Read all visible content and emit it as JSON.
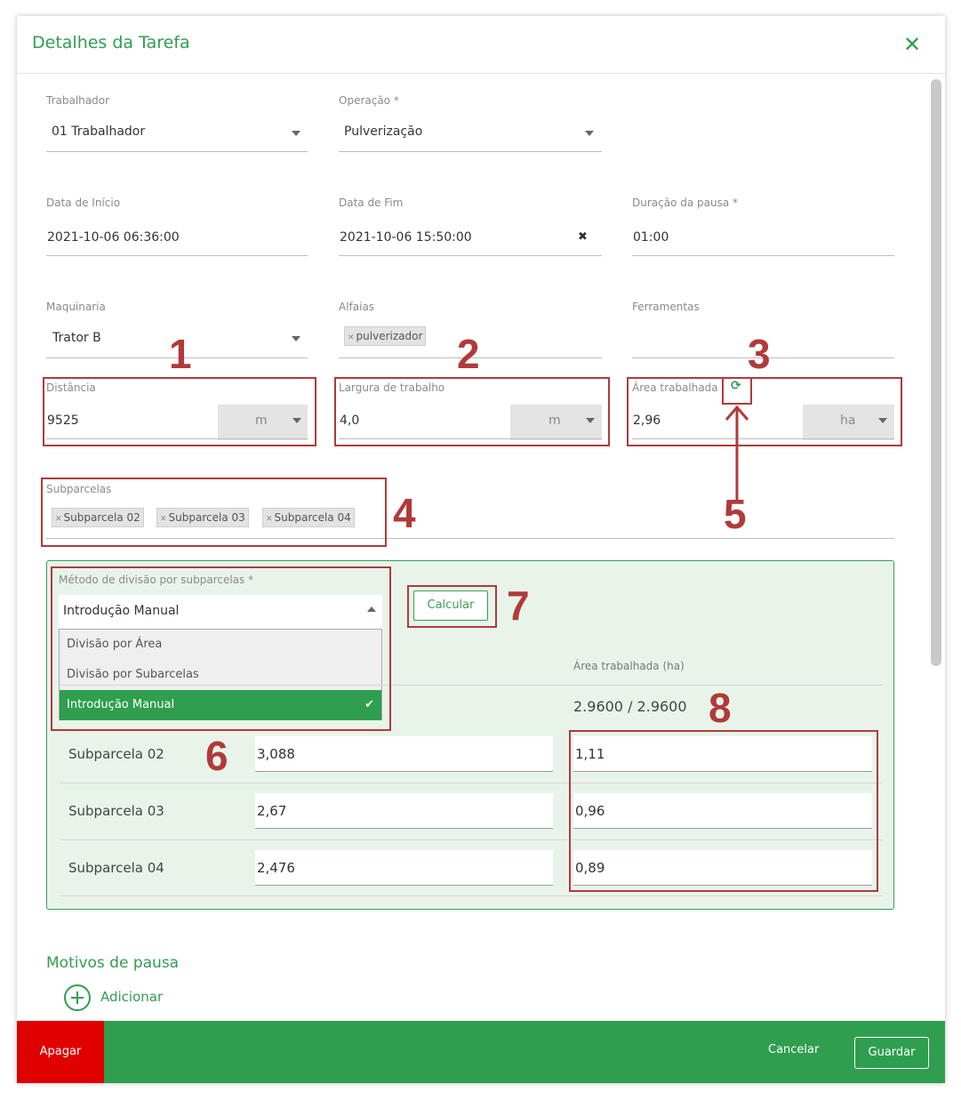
{
  "header": {
    "title": "Detalhes da Tarefa",
    "close_icon": "close-icon"
  },
  "worker": {
    "label": "Trabalhador",
    "value": "01 Trabalhador"
  },
  "operation": {
    "label": "Operação *",
    "value": "Pulverização"
  },
  "start_date": {
    "label": "Data de Início",
    "value": "2021-10-06 06:36:00"
  },
  "end_date": {
    "label": "Data de Fim",
    "value": "2021-10-06 15:50:00",
    "clear": "✖"
  },
  "pause_duration": {
    "label": "Duração da pausa *",
    "value": "01:00"
  },
  "machinery": {
    "label": "Maquinaria",
    "value": "Trator B"
  },
  "implements": {
    "label": "Alfaias",
    "chips": [
      "pulverizador"
    ]
  },
  "tools": {
    "label": "Ferramentas",
    "value": ""
  },
  "distance": {
    "label": "Distância",
    "value": "9525",
    "unit": "m"
  },
  "work_width": {
    "label": "Largura de trabalho",
    "value": "4,0",
    "unit": "m"
  },
  "worked_area": {
    "label": "Área trabalhada",
    "value": "2,96",
    "unit": "ha",
    "refresh_icon": "refresh-icon"
  },
  "subplots": {
    "label": "Subparcelas",
    "chips": [
      "Subparcela 02",
      "Subparcela 03",
      "Subparcela 04"
    ]
  },
  "division": {
    "label": "Método de divisão por subparcelas *",
    "selected": "Introdução Manual",
    "options": [
      "Divisão por Área",
      "Divisão por Subarcelas",
      "Introdução Manual"
    ],
    "calculate": "Calcular",
    "area_header": "Área trabalhada (ha)",
    "area_total": "2.9600 / 2.9600",
    "rows": [
      {
        "name": "Subparcela 02",
        "size": "3,088",
        "area": "1,11"
      },
      {
        "name": "Subparcela 03",
        "size": "2,67",
        "area": "0,96"
      },
      {
        "name": "Subparcela 04",
        "size": "2,476",
        "area": "0,89"
      }
    ]
  },
  "annotations": [
    "1",
    "2",
    "3",
    "4",
    "5",
    "6",
    "7",
    "8"
  ],
  "pause_reasons": {
    "title": "Motivos de pausa",
    "add": "Adicionar"
  },
  "footer": {
    "delete": "Apagar",
    "cancel": "Cancelar",
    "save": "Guardar"
  },
  "colors": {
    "brand_green": "#2f9e4f",
    "annotation_red": "#b13a3a",
    "delete_red": "#e00000",
    "panel_bg": "#e8f4ea"
  }
}
